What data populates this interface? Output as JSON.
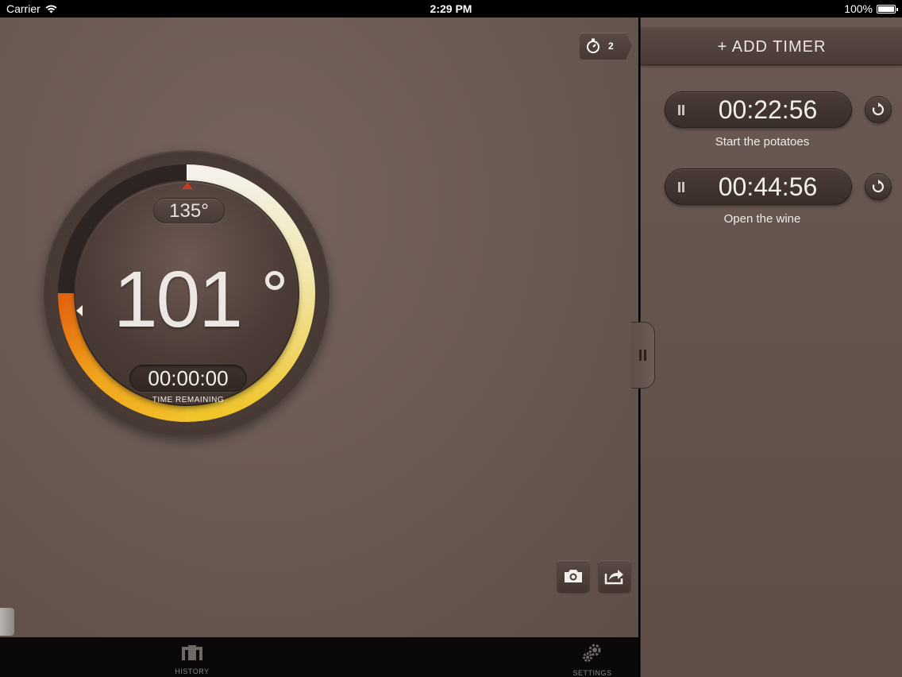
{
  "status_bar": {
    "carrier": "Carrier",
    "time": "2:29 PM",
    "battery": "100%"
  },
  "main": {
    "timer_badge_count": "2",
    "target_temp": "135°",
    "current_temp": "101",
    "countdown": "00:00:00",
    "countdown_label": "TIME REMAINING",
    "dial_progress_fraction": 0.75,
    "colors": {
      "hot_orange": "#e8660f",
      "yellow": "#f2d23a",
      "cream": "#f1ece4",
      "track": "#2e2421"
    }
  },
  "tabs": [
    {
      "label": "HISTORY",
      "icon": "history-icon"
    },
    {
      "label": "SETTINGS",
      "icon": "settings-gear-icon"
    }
  ],
  "sidebar": {
    "add_timer_label": "+ ADD TIMER",
    "timers": [
      {
        "time": "00:22:56",
        "label": "Start the potatoes"
      },
      {
        "time": "00:44:56",
        "label": "Open the wine"
      }
    ]
  }
}
